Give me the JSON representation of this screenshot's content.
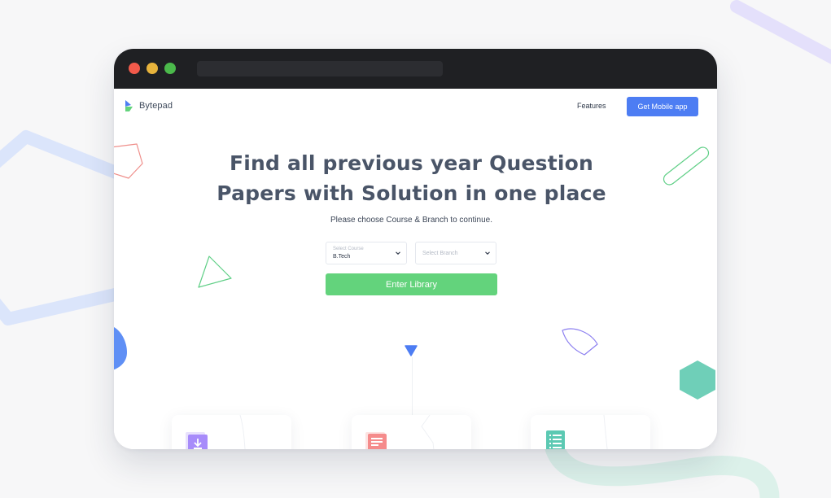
{
  "app": {
    "brand": "Bytepad"
  },
  "nav": {
    "features_label": "Features",
    "cta_label": "Get Mobile app"
  },
  "hero": {
    "title_line1": "Find all previous year Question",
    "title_line2": "Papers with Solution in one place",
    "subtitle": "Please choose Course & Branch to continue."
  },
  "form": {
    "course": {
      "label": "Select Course",
      "value": "B.Tech"
    },
    "branch": {
      "placeholder": "Select Branch"
    },
    "submit_label": "Enter Library"
  },
  "features": [
    {
      "icon": "download-icon",
      "color": "#a78bfa"
    },
    {
      "icon": "document-icon",
      "color": "#f58b8b"
    },
    {
      "icon": "list-icon",
      "color": "#5cc9b3"
    }
  ],
  "colors": {
    "primary": "#4d7df3",
    "success": "#63d37c",
    "title_text": "#4a5568"
  }
}
